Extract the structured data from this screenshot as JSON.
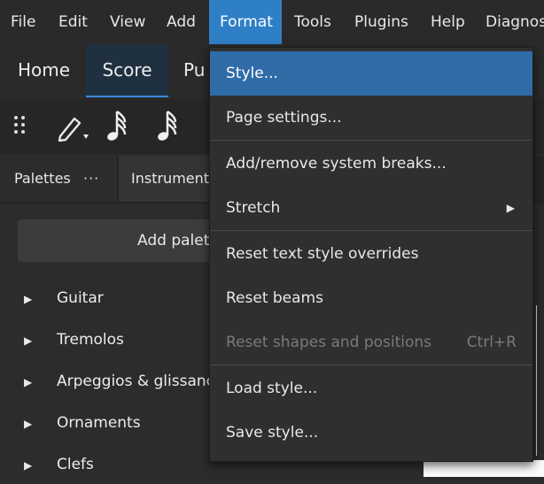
{
  "menubar": {
    "items": [
      "File",
      "Edit",
      "View",
      "Add",
      "Format",
      "Tools",
      "Plugins",
      "Help",
      "Diagnos"
    ]
  },
  "workspace_tabs": [
    "Home",
    "Score",
    "Pu"
  ],
  "toolbar": {
    "icons": [
      "drag-handle-icon",
      "pencil-icon",
      "sixteenth-note-icon",
      "sixteenth-note-icon"
    ]
  },
  "dock": {
    "palettes_tab": "Palettes",
    "more": "···",
    "instruments_tab": "Instrument"
  },
  "palettes_panel": {
    "add_button": "Add palet",
    "items": [
      "Guitar",
      "Tremolos",
      "Arpeggios & glissanc",
      "Ornaments",
      "Clefs"
    ]
  },
  "format_menu": {
    "items": [
      {
        "label": "Style...",
        "highlighted": true
      },
      {
        "label": "Page settings..."
      },
      {
        "label": "Add/remove system breaks..."
      },
      {
        "label": "Stretch",
        "submenu": true
      },
      {
        "label": "Reset text style overrides"
      },
      {
        "label": "Reset beams"
      },
      {
        "label": "Reset shapes and positions",
        "shortcut": "Ctrl+R",
        "disabled": true
      },
      {
        "label": "Load style..."
      },
      {
        "label": "Save style..."
      }
    ]
  },
  "colors": {
    "accent": "#2f7fc6",
    "highlight": "#2f6ca8",
    "background": "#2b2b2b"
  }
}
